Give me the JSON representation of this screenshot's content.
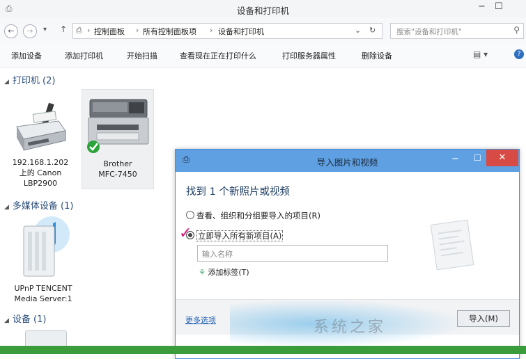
{
  "window": {
    "title": "设备和打印机",
    "controls": {
      "minimize": "−",
      "maximize": "☐"
    }
  },
  "nav": {
    "back": "←",
    "forward": "→",
    "recent": "▾",
    "up": "↑",
    "breadcrumb": [
      "控制面板",
      "所有控制面板项",
      "设备和打印机"
    ],
    "separator": "›",
    "dropdown": "⌄",
    "refresh": "↻",
    "search_placeholder": "搜索\"设备和打印机\""
  },
  "toolbar": {
    "items": [
      "添加设备",
      "添加打印机",
      "开始扫描",
      "查看现在正在打印什么",
      "打印服务器属性",
      "删除设备"
    ],
    "view_icon": "▤ ▾",
    "help": "?"
  },
  "groups": [
    {
      "label": "打印机 (2)",
      "arrow": "◢"
    },
    {
      "label": "多媒体设备 (1)",
      "arrow": "◢"
    },
    {
      "label": "设备 (1)",
      "arrow": "◢"
    }
  ],
  "devices": {
    "printer1": [
      "192.168.1.202",
      "上的 Canon",
      "LBP2900"
    ],
    "printer2": [
      "Brother",
      "MFC-7450"
    ],
    "media1": [
      "UPnP TENCENT",
      "Media Server:1"
    ]
  },
  "dialog": {
    "title": "导入图片和视频",
    "minimize": "−",
    "maximize": "☐",
    "close": "✕",
    "heading": "找到 1 个新照片或视频",
    "option1": "查看、组织和分组要导入的项目(R)",
    "option2": "立即导入所有新项目(A)",
    "selected_option": 2,
    "name_placeholder": "输入名称",
    "add_tags": "添加标签(T)",
    "more_options": "更多选项",
    "import_button": "导入(M)"
  },
  "colors": {
    "dialog_title": "#5fa0e3",
    "close_button": "#d84a44",
    "annotation_check": "#d4147a",
    "taskbar": "#3a9c3a",
    "default_check": "#2aa33a"
  }
}
